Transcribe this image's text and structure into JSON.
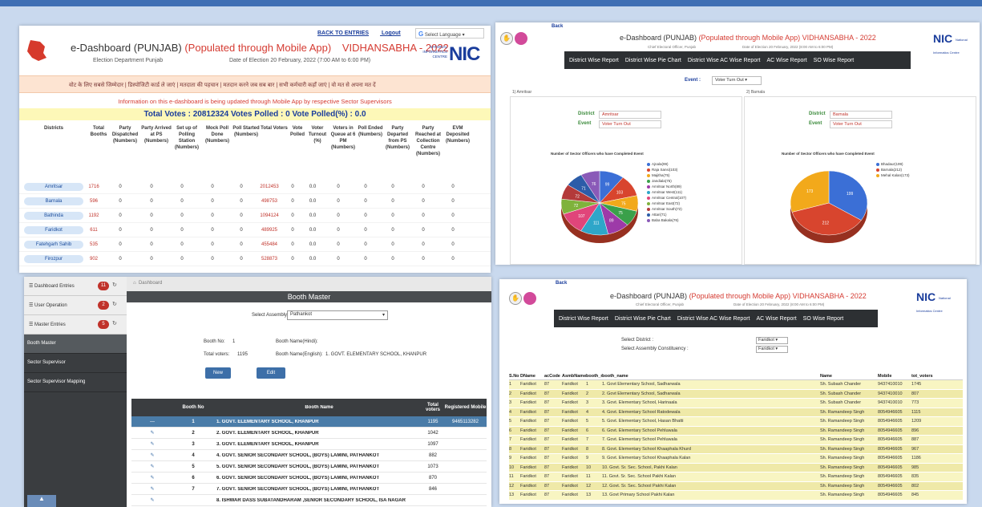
{
  "panel1": {
    "title_main": "e-Dashboard (PUNJAB)",
    "title_app": "(Populated through Mobile App)",
    "title_event": "VIDHANSABHA - 2022",
    "subtitle": "Election Department Punjab",
    "date_line": "Date of Election 20 February, 2022 (7:00 AM to 6:00 PM)",
    "links": [
      "BACK TO ENTRIES",
      "Logout"
    ],
    "language_label": "Select Language",
    "nic_small": "NATIONAL INFORMATICS CENTRE",
    "nic_logo": "NIC",
    "marquee": "वोट के लिए सबसे जिम्मेदार | डिस्पोजिटी कार्ड ले जाएं | मतदाता की पहचान | मतदान करने जब सब बार | सभी कर्मचारी कहाँ जाएं | वो मत से अपना मत दें",
    "info": "Information on this e-dashboard is being updated through Mobile App by respective Sector Supervisors",
    "totals": "Total Votes : 20812324   Votes Polled : 0   Vote Polled(%) : 0.0",
    "columns": [
      "Districts",
      "Total Booths",
      "Party Dispatched (Numbers)",
      "Party Arrived at PS (Numbers)",
      "Set up of Polling Station (Numbers)",
      "Mock Poll Done (Numbers)",
      "Poll Started (Numbers)",
      "Total Voters",
      "Vote Polled",
      "Voter Turnout (%)",
      "Voters in Queue at 6 PM (Numbers)",
      "Poll Ended (Numbers)",
      "Party Departed from PS (Numbers)",
      "Party Reached at Collection Centre (Numbers)",
      "EVM Deposited (Numbers)"
    ],
    "rows": [
      [
        "Amritsar",
        "1716",
        "0",
        "0",
        "0",
        "0",
        "0",
        "2012453",
        "0",
        "0.0",
        "0",
        "0",
        "0",
        "0",
        "0"
      ],
      [
        "Barnala",
        "596",
        "0",
        "0",
        "0",
        "0",
        "0",
        "498753",
        "0",
        "0.0",
        "0",
        "0",
        "0",
        "0",
        "0"
      ],
      [
        "Bathinda",
        "1192",
        "0",
        "0",
        "0",
        "0",
        "0",
        "1094124",
        "0",
        "0.0",
        "0",
        "0",
        "0",
        "0",
        "0"
      ],
      [
        "Faridkot",
        "611",
        "0",
        "0",
        "0",
        "0",
        "0",
        "489925",
        "0",
        "0.0",
        "0",
        "0",
        "0",
        "0",
        "0"
      ],
      [
        "Fatehgarh Sahib",
        "535",
        "0",
        "0",
        "0",
        "0",
        "0",
        "455484",
        "0",
        "0.0",
        "0",
        "0",
        "0",
        "0",
        "0"
      ],
      [
        "Firozpur",
        "902",
        "0",
        "0",
        "0",
        "0",
        "0",
        "528873",
        "0",
        "0.0",
        "0",
        "0",
        "0",
        "0",
        "0"
      ]
    ]
  },
  "panel2": {
    "back": "Back",
    "title_main": "e-Dashboard (PUNJAB)",
    "title_app": "(Populated through Mobile App)",
    "title_event": "VIDHANSABHA - 2022",
    "subtitle": "Chief Electoral Officer, Punjab",
    "date_line": "Date of Election 20 February, 2022 (8:00 AM to 6:00 PM)",
    "nic_logo": "NIC",
    "nic_small": "National Informatics Centre",
    "nav": [
      "District Wise Report",
      "District Wise Pie Chart",
      "District Wise AC Wise Report",
      "AC Wise Report",
      "SO Wise Report"
    ],
    "event_label": "Event :",
    "event_value": "Voter Turn Out",
    "charts": [
      {
        "tag": "1) Amritsar",
        "district_label": "District",
        "district_value": "Amritsar",
        "event_label": "Event",
        "event_value": "Voter Turn Out",
        "title": "Number of Sector Officers who have Completed Event",
        "legend": [
          "Ajnala(99)",
          "Raja Sansi(103)",
          "Majitha(75)",
          "Jandiala(75)",
          "Amritsar North(89)",
          "Amritsar West(111)",
          "Amritsar Central(107)",
          "Amritsar East(72)",
          "Amritsar South(72)",
          "Attari(71)",
          "Baba Bakala(76)"
        ],
        "legend_colors": [
          "#3b6fd6",
          "#d8452e",
          "#f2a91b",
          "#3aa04a",
          "#9d3aa8",
          "#2ea6c9",
          "#e0457a",
          "#7fb23c",
          "#b33a3a",
          "#2c5ca8",
          "#8a5ab8"
        ],
        "slices": [
          99,
          103,
          75,
          75,
          89,
          111,
          107,
          72,
          72,
          71,
          76
        ]
      },
      {
        "tag": "2) Barnala",
        "district_label": "District",
        "district_value": "Barnala",
        "event_label": "Event",
        "event_value": "Voter Turn Out",
        "title": "Number of Sector Officers who have Completed Event",
        "legend": [
          "Bhadaur(199)",
          "Barnala(212)",
          "Mehal Kalan(173)"
        ],
        "legend_colors": [
          "#3b6fd6",
          "#d8452e",
          "#f2a91b"
        ],
        "slices": [
          199,
          212,
          173
        ]
      }
    ]
  },
  "panel3": {
    "menu": [
      {
        "label": "Dashboard Entries",
        "badge": "11"
      },
      {
        "label": "User Operation",
        "badge": "2"
      },
      {
        "label": "Master Entries",
        "badge": "5"
      }
    ],
    "side_items": [
      "Booth Master",
      "Sector Supervisor",
      "Sector Supervisor Mapping"
    ],
    "breadcrumb": "Dashboard",
    "title": "Booth Master",
    "select_label": "Select Assembly:",
    "select_value": "Pathankot",
    "booth_no_label": "Booth No:",
    "booth_no_value": "1",
    "booth_name_hindi_label": "Booth Name(Hindi):",
    "total_voters_label": "Total voters:",
    "total_voters_value": "1195",
    "booth_name_english_label": "Booth Name(English):",
    "booth_name_english_value": "1. GOVT. ELEMENTARY SCHOOL, KHANPUR",
    "btn_new": "New",
    "btn_edit": "Edit",
    "columns": [
      "Booth No",
      "Booth Name",
      "Total voters",
      "Registered Mobile"
    ],
    "rows": [
      [
        "1",
        "1. GOVT. ELEMENTARY SCHOOL, KHANPUR",
        "1195",
        "9465113282"
      ],
      [
        "2",
        "2. GOVT. ELEMENTARY SCHOOL, KHANPUR",
        "1042",
        ""
      ],
      [
        "3",
        "3. GOVT. ELEMENTARY SCHOOL, KHANPUR",
        "1097",
        ""
      ],
      [
        "4",
        "4. GOVT. SENIOR SECONDARY SCHOOL, (BOYS) LAMINI, PATHANKOT",
        "882",
        ""
      ],
      [
        "5",
        "5. GOVT. SENIOR SECONDARY SCHOOL, (BOYS) LAMINI, PATHANKOT",
        "1073",
        ""
      ],
      [
        "6",
        "6. GOVT. SENIOR SECONDARY SCHOOL, (BOYS) LAMINI, PATHANKOT",
        "870",
        ""
      ],
      [
        "7",
        "7. GOVT. SENIOR SECONDARY SCHOOL, (BOYS) LAMINI, PATHANKOT",
        "846",
        ""
      ],
      [
        "",
        "8. ISHWAR DASS SUBATANDHARAM ,SENIOR SECONDARY SCHOOL, ISA NAGAR",
        "",
        ""
      ]
    ]
  },
  "panel4": {
    "back": "Back",
    "title_main": "e-Dashboard (PUNJAB)",
    "title_app": "(Populated through Mobile App)",
    "title_event": "VIDHANSABHA - 2022",
    "subtitle": "Chief Electoral Officer, Punjab",
    "date_line": "Date of Election 20 February, 2022 (8:00 AM to 6:00 PM)",
    "nic_logo": "NIC",
    "nic_small": "National Informatics Centre",
    "nav": [
      "District Wise Report",
      "District Wise Pie Chart",
      "District Wise AC Wise Report",
      "AC Wise Report",
      "SO Wise Report"
    ],
    "select_district_label": "Select District :",
    "select_district_value": "Faridkot",
    "select_ac_label": "Select Assembly Constituency :",
    "select_ac_value": "Faridkot",
    "columns": [
      "S.No",
      "DName",
      "acCode",
      "AsmbName",
      "booth_no",
      "booth_name",
      "Name",
      "Mobile",
      "tot_voters"
    ],
    "rows": [
      [
        "1",
        "Faridkot",
        "87",
        "Faridkot",
        "1",
        "1. Govt Elementary School, Sadharwala",
        "Sh. Subash Chander",
        "9437410010",
        "1745"
      ],
      [
        "2",
        "Faridkot",
        "87",
        "Faridkot",
        "2",
        "2. Govt Elementary School, Sadharwala",
        "Sh. Subash Chander",
        "9437410010",
        "807"
      ],
      [
        "3",
        "Faridkot",
        "87",
        "Faridkot",
        "3",
        "3. Govt. Elementary School, Harinaala",
        "Sh. Subash Chander",
        "9437410010",
        "773"
      ],
      [
        "4",
        "Faridkot",
        "87",
        "Faridkot",
        "4",
        "4. Govt. Elementary School Ratodewala",
        "Sh. Ramandeep Singh",
        "8054946605",
        "1115"
      ],
      [
        "5",
        "Faridkot",
        "87",
        "Faridkot",
        "5",
        "5. Govt. Elementary School, Hasan Bhatti",
        "Sh. Ramandeep Singh",
        "8054946605",
        "1209"
      ],
      [
        "6",
        "Faridkot",
        "87",
        "Faridkot",
        "6",
        "6. Govt. Elementary School Pehluwala",
        "Sh. Ramandeep Singh",
        "8054946605",
        "896"
      ],
      [
        "7",
        "Faridkot",
        "87",
        "Faridkot",
        "7",
        "7. Govt. Elementary School Pehluwala",
        "Sh. Ramandeep Singh",
        "8054946605",
        "887"
      ],
      [
        "8",
        "Faridkot",
        "87",
        "Faridkot",
        "8",
        "8. Govt. Elementary School Khaaphala Khurd",
        "Sh. Ramandeep Singh",
        "8054946605",
        "967"
      ],
      [
        "9",
        "Faridkot",
        "87",
        "Faridkot",
        "9",
        "9. Govt. Elementary School Khaaphala Kalan",
        "Sh. Ramandeep Singh",
        "8054946605",
        "1186"
      ],
      [
        "10",
        "Faridkot",
        "87",
        "Faridkot",
        "10",
        "10. Govt. Sr. Sec. School, Pakhi Kalan",
        "Sh. Ramandeep Singh",
        "8054946605",
        "985"
      ],
      [
        "11",
        "Faridkot",
        "87",
        "Faridkot",
        "11",
        "11. Govt. Sr. Sec. School Pakhi Kalan",
        "Sh. Ramandeep Singh",
        "8054946605",
        "835"
      ],
      [
        "12",
        "Faridkot",
        "87",
        "Faridkot",
        "12",
        "12. Govt. Sr. Sec. School Pakhi Kalan",
        "Sh. Ramandeep Singh",
        "8054946605",
        "802"
      ],
      [
        "13",
        "Faridkot",
        "87",
        "Faridkot",
        "13",
        "13. Govt Primary School Pakhi Kalan",
        "Sh. Ramandeep Singh",
        "8054946605",
        "845"
      ]
    ]
  }
}
